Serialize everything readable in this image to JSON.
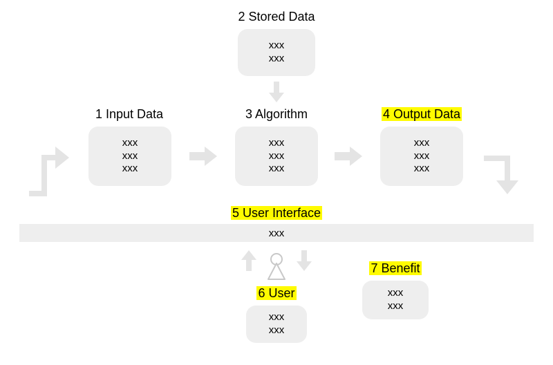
{
  "nodes": {
    "stored": {
      "title": "2 Stored Data",
      "lines": [
        "xxx",
        "xxx"
      ]
    },
    "input": {
      "title": "1 Input Data",
      "lines": [
        "xxx",
        "xxx",
        "xxx"
      ]
    },
    "algo": {
      "title": "3 Algorithm",
      "lines": [
        "xxx",
        "xxx",
        "xxx"
      ]
    },
    "output": {
      "title": "4 Output Data",
      "lines": [
        "xxx",
        "xxx",
        "xxx"
      ],
      "highlighted": true
    },
    "ui": {
      "title": "5 User Interface",
      "lines": [
        "xxx"
      ],
      "highlighted": true
    },
    "user": {
      "title": "6 User",
      "lines": [
        "xxx",
        "xxx"
      ],
      "highlighted": true
    },
    "benefit": {
      "title": "7 Benefit",
      "lines": [
        "xxx",
        "xxx"
      ],
      "highlighted": true
    }
  },
  "style": {
    "highlight_color": "#fffb00",
    "box_bg": "#eeeeee",
    "arrow_color": "#e4e4e4"
  },
  "footer": ""
}
